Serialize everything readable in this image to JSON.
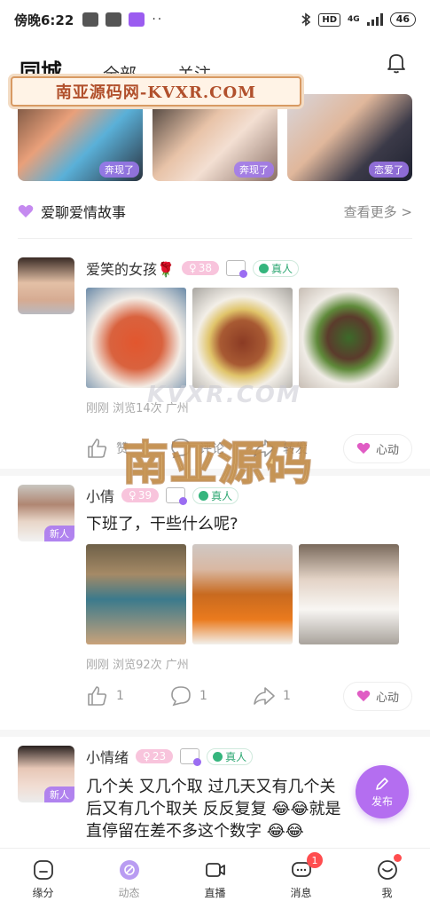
{
  "status_bar": {
    "time": "傍晚6:22",
    "network": "4G",
    "hd": "HD",
    "battery": "46"
  },
  "header": {
    "tabs": [
      {
        "label": "同城",
        "active": true
      },
      {
        "label": "全部",
        "active": false
      },
      {
        "label": "关注",
        "active": false
      }
    ]
  },
  "watermark": {
    "banner_text": "南亚源码网-KVXR.COM",
    "center_text": "南亚源码",
    "center_small": "KVXR.COM"
  },
  "stories": [
    {
      "tag": "奔现了"
    },
    {
      "tag": "奔现了"
    },
    {
      "tag": "恋爱了"
    }
  ],
  "love_stories": {
    "title": "爱聊爱情故事",
    "more": "查看更多 >"
  },
  "posts": [
    {
      "name": "爱笑的女孩🌹",
      "age": "38",
      "real": "真人",
      "text": "",
      "meta": "刚刚 浏览14次 广州",
      "likes": "赞",
      "comments": "评论",
      "shares": "转发",
      "xindong": "心动"
    },
    {
      "name": "小倩",
      "age": "39",
      "real": "真人",
      "new_tag": "新人",
      "text": "下班了，干些什么呢?",
      "meta": "刚刚 浏览92次 广州",
      "likes": "1",
      "comments": "1",
      "shares": "1",
      "xindong": "心动"
    },
    {
      "name": "小情绪",
      "age": "23",
      "real": "真人",
      "new_tag": "新人",
      "text_lines": [
        "几个关 又几个取 过几天又有几个关",
        "后又有几个取关 反反复复 😂😂就是",
        "直停留在差不多这个数字 😂😂"
      ]
    }
  ],
  "fab": {
    "label": "发布"
  },
  "bottom_nav": [
    {
      "label": "缘分",
      "icon": "fate-icon"
    },
    {
      "label": "动态",
      "icon": "moments-icon",
      "active": true
    },
    {
      "label": "直播",
      "icon": "live-icon"
    },
    {
      "label": "消息",
      "icon": "message-icon",
      "badge": "1"
    },
    {
      "label": "我",
      "icon": "profile-icon",
      "dot": true
    }
  ],
  "colors": {
    "accent": "#b46ef0",
    "age_pill": "#f8c4dc",
    "real_green": "#35b57d",
    "badge_red": "#ff4d4f"
  }
}
